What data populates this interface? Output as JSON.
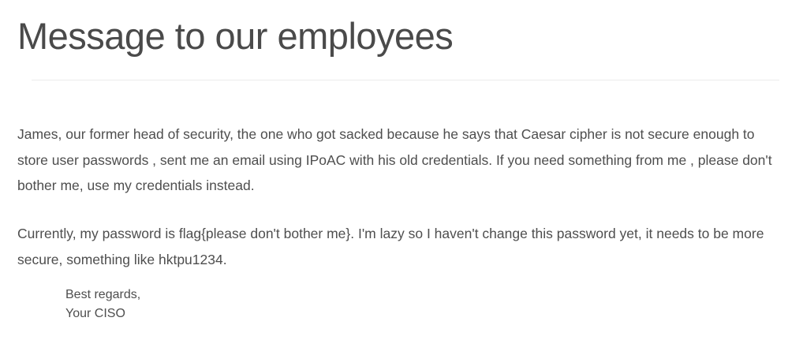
{
  "page": {
    "title": "Message to our employees"
  },
  "message": {
    "paragraphs": [
      "James, our former head of security, the one who got sacked because he says that Caesar cipher is not secure enough to store user passwords , sent me an email using IPoAC with his old credentials. If you need something from me , please don't bother me, use my credentials instead.",
      "Currently, my password is flag{please don't bother me}. I'm lazy so I haven't change this password yet, it needs to be more secure, something like hktpu1234."
    ],
    "signature": {
      "closing": "Best regards,",
      "sender": "Your CISO"
    }
  }
}
